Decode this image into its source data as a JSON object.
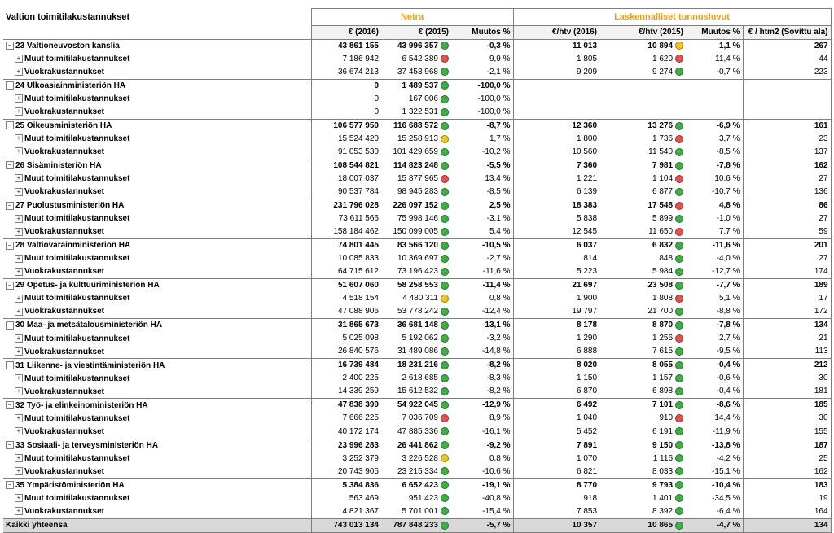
{
  "title": "Valtion toimitilakustannukset",
  "group_headers": {
    "netra": "Netra",
    "lask": "Laskennalliset tunnusluvut"
  },
  "columns": [
    "€ (2016)",
    "€ (2015)",
    "Muutos %",
    "€/htv (2016)",
    "€/htv (2015)",
    "Muutos %",
    "€ / htm2 (Sovittu ala)"
  ],
  "status_colors": {
    "green": "#3cb043",
    "red": "#e8504a",
    "yellow": "#f5c518"
  },
  "toggle_glyphs": {
    "group": "−",
    "sub": "+"
  },
  "rows": [
    {
      "type": "grp",
      "label": "23 Valtioneuvoston kanslia",
      "c2016": "43 861 155",
      "c2015": "43 996 357",
      "s1": "green",
      "p1": "-0,3 %",
      "h2016": "11 013",
      "h2015": "10 894",
      "s2": "yellow",
      "p2": "1,1 %",
      "htm": "267"
    },
    {
      "type": "sub",
      "label": "Muut toimitilakustannukset",
      "c2016": "7 186 942",
      "c2015": "6 542 389",
      "s1": "red",
      "p1": "9,9 %",
      "h2016": "1 805",
      "h2015": "1 620",
      "s2": "red",
      "p2": "11,4 %",
      "htm": "44"
    },
    {
      "type": "sub",
      "label": "Vuokrakustannukset",
      "c2016": "36 674 213",
      "c2015": "37 453 968",
      "s1": "green",
      "p1": "-2,1 %",
      "h2016": "9 209",
      "h2015": "9 274",
      "s2": "green",
      "p2": "-0,7 %",
      "htm": "223"
    },
    {
      "type": "grp",
      "label": "24 Ulkoasiainministeriön HA",
      "c2016": "0",
      "c2015": "1 489 537",
      "s1": "green",
      "p1": "-100,0 %",
      "h2016": "",
      "h2015": "",
      "s2": "",
      "p2": "",
      "htm": ""
    },
    {
      "type": "sub",
      "label": "Muut toimitilakustannukset",
      "c2016": "0",
      "c2015": "167 006",
      "s1": "green",
      "p1": "-100,0 %",
      "h2016": "",
      "h2015": "",
      "s2": "",
      "p2": "",
      "htm": ""
    },
    {
      "type": "sub",
      "label": "Vuokrakustannukset",
      "c2016": "0",
      "c2015": "1 322 531",
      "s1": "green",
      "p1": "-100,0 %",
      "h2016": "",
      "h2015": "",
      "s2": "",
      "p2": "",
      "htm": ""
    },
    {
      "type": "grp",
      "label": "25 Oikeusministeriön HA",
      "c2016": "106 577 950",
      "c2015": "116 688 572",
      "s1": "green",
      "p1": "-8,7 %",
      "h2016": "12 360",
      "h2015": "13 276",
      "s2": "green",
      "p2": "-6,9 %",
      "htm": "161"
    },
    {
      "type": "sub",
      "label": "Muut toimitilakustannukset",
      "c2016": "15 524 420",
      "c2015": "15 258 913",
      "s1": "yellow",
      "p1": "1,7 %",
      "h2016": "1 800",
      "h2015": "1 736",
      "s2": "red",
      "p2": "3,7 %",
      "htm": "23"
    },
    {
      "type": "sub",
      "label": "Vuokrakustannukset",
      "c2016": "91 053 530",
      "c2015": "101 429 659",
      "s1": "green",
      "p1": "-10,2 %",
      "h2016": "10 560",
      "h2015": "11 540",
      "s2": "green",
      "p2": "-8,5 %",
      "htm": "137"
    },
    {
      "type": "grp",
      "label": "26 Sisäministeriön HA",
      "c2016": "108 544 821",
      "c2015": "114 823 248",
      "s1": "green",
      "p1": "-5,5 %",
      "h2016": "7 360",
      "h2015": "7 981",
      "s2": "green",
      "p2": "-7,8 %",
      "htm": "162"
    },
    {
      "type": "sub",
      "label": "Muut toimitilakustannukset",
      "c2016": "18 007 037",
      "c2015": "15 877 965",
      "s1": "red",
      "p1": "13,4 %",
      "h2016": "1 221",
      "h2015": "1 104",
      "s2": "red",
      "p2": "10,6 %",
      "htm": "27"
    },
    {
      "type": "sub",
      "label": "Vuokrakustannukset",
      "c2016": "90 537 784",
      "c2015": "98 945 283",
      "s1": "green",
      "p1": "-8,5 %",
      "h2016": "6 139",
      "h2015": "6 877",
      "s2": "green",
      "p2": "-10,7 %",
      "htm": "136"
    },
    {
      "type": "grp",
      "label": "27 Puolustusministeriön HA",
      "c2016": "231 796 028",
      "c2015": "226 097 152",
      "s1": "green",
      "p1": "2,5 %",
      "h2016": "18 383",
      "h2015": "17 548",
      "s2": "red",
      "p2": "4,8 %",
      "htm": "86"
    },
    {
      "type": "sub",
      "label": "Muut toimitilakustannukset",
      "c2016": "73 611 566",
      "c2015": "75 998 146",
      "s1": "green",
      "p1": "-3,1 %",
      "h2016": "5 838",
      "h2015": "5 899",
      "s2": "green",
      "p2": "-1,0 %",
      "htm": "27"
    },
    {
      "type": "sub",
      "label": "Vuokrakustannukset",
      "c2016": "158 184 462",
      "c2015": "150 099 005",
      "s1": "green",
      "p1": "5,4 %",
      "h2016": "12 545",
      "h2015": "11 650",
      "s2": "red",
      "p2": "7,7 %",
      "htm": "59"
    },
    {
      "type": "grp",
      "label": "28 Valtiovarainministeriön HA",
      "c2016": "74 801 445",
      "c2015": "83 566 120",
      "s1": "green",
      "p1": "-10,5 %",
      "h2016": "6 037",
      "h2015": "6 832",
      "s2": "green",
      "p2": "-11,6 %",
      "htm": "201"
    },
    {
      "type": "sub",
      "label": "Muut toimitilakustannukset",
      "c2016": "10 085 833",
      "c2015": "10 369 697",
      "s1": "green",
      "p1": "-2,7 %",
      "h2016": "814",
      "h2015": "848",
      "s2": "green",
      "p2": "-4,0 %",
      "htm": "27"
    },
    {
      "type": "sub",
      "label": "Vuokrakustannukset",
      "c2016": "64 715 612",
      "c2015": "73 196 423",
      "s1": "green",
      "p1": "-11,6 %",
      "h2016": "5 223",
      "h2015": "5 984",
      "s2": "green",
      "p2": "-12,7 %",
      "htm": "174"
    },
    {
      "type": "grp",
      "label": "29 Opetus- ja kulttuuriministeriön HA",
      "c2016": "51 607 060",
      "c2015": "58 258 553",
      "s1": "green",
      "p1": "-11,4 %",
      "h2016": "21 697",
      "h2015": "23 508",
      "s2": "green",
      "p2": "-7,7 %",
      "htm": "189"
    },
    {
      "type": "sub",
      "label": "Muut toimitilakustannukset",
      "c2016": "4 518 154",
      "c2015": "4 480 311",
      "s1": "yellow",
      "p1": "0,8 %",
      "h2016": "1 900",
      "h2015": "1 808",
      "s2": "red",
      "p2": "5,1 %",
      "htm": "17"
    },
    {
      "type": "sub",
      "label": "Vuokrakustannukset",
      "c2016": "47 088 906",
      "c2015": "53 778 242",
      "s1": "green",
      "p1": "-12,4 %",
      "h2016": "19 797",
      "h2015": "21 700",
      "s2": "green",
      "p2": "-8,8 %",
      "htm": "172"
    },
    {
      "type": "grp",
      "label": "30 Maa- ja metsätalousministeriön HA",
      "c2016": "31 865 673",
      "c2015": "36 681 148",
      "s1": "green",
      "p1": "-13,1 %",
      "h2016": "8 178",
      "h2015": "8 870",
      "s2": "green",
      "p2": "-7,8 %",
      "htm": "134"
    },
    {
      "type": "sub",
      "label": "Muut toimitilakustannukset",
      "c2016": "5 025 098",
      "c2015": "5 192 062",
      "s1": "green",
      "p1": "-3,2 %",
      "h2016": "1 290",
      "h2015": "1 256",
      "s2": "red",
      "p2": "2,7 %",
      "htm": "21"
    },
    {
      "type": "sub",
      "label": "Vuokrakustannukset",
      "c2016": "26 840 576",
      "c2015": "31 489 086",
      "s1": "green",
      "p1": "-14,8 %",
      "h2016": "6 888",
      "h2015": "7 615",
      "s2": "green",
      "p2": "-9,5 %",
      "htm": "113"
    },
    {
      "type": "grp",
      "label": "31 Liikenne- ja viestintäministeriön HA",
      "c2016": "16 739 484",
      "c2015": "18 231 216",
      "s1": "green",
      "p1": "-8,2 %",
      "h2016": "8 020",
      "h2015": "8 055",
      "s2": "green",
      "p2": "-0,4 %",
      "htm": "212"
    },
    {
      "type": "sub",
      "label": "Muut toimitilakustannukset",
      "c2016": "2 400 225",
      "c2015": "2 618 685",
      "s1": "green",
      "p1": "-8,3 %",
      "h2016": "1 150",
      "h2015": "1 157",
      "s2": "green",
      "p2": "-0,6 %",
      "htm": "30"
    },
    {
      "type": "sub",
      "label": "Vuokrakustannukset",
      "c2016": "14 339 259",
      "c2015": "15 612 532",
      "s1": "green",
      "p1": "-8,2 %",
      "h2016": "6 870",
      "h2015": "6 898",
      "s2": "green",
      "p2": "-0,4 %",
      "htm": "181"
    },
    {
      "type": "grp",
      "label": "32 Työ- ja elinkeinoministeriön HA",
      "c2016": "47 838 399",
      "c2015": "54 922 045",
      "s1": "green",
      "p1": "-12,9 %",
      "h2016": "6 492",
      "h2015": "7 101",
      "s2": "green",
      "p2": "-8,6 %",
      "htm": "185"
    },
    {
      "type": "sub",
      "label": "Muut toimitilakustannukset",
      "c2016": "7 666 225",
      "c2015": "7 036 709",
      "s1": "red",
      "p1": "8,9 %",
      "h2016": "1 040",
      "h2015": "910",
      "s2": "red",
      "p2": "14,4 %",
      "htm": "30"
    },
    {
      "type": "sub",
      "label": "Vuokrakustannukset",
      "c2016": "40 172 174",
      "c2015": "47 885 336",
      "s1": "green",
      "p1": "-16,1 %",
      "h2016": "5 452",
      "h2015": "6 191",
      "s2": "green",
      "p2": "-11,9 %",
      "htm": "155"
    },
    {
      "type": "grp",
      "label": "33 Sosiaali- ja terveysministeriön HA",
      "c2016": "23 996 283",
      "c2015": "26 441 862",
      "s1": "green",
      "p1": "-9,2 %",
      "h2016": "7 891",
      "h2015": "9 150",
      "s2": "green",
      "p2": "-13,8 %",
      "htm": "187"
    },
    {
      "type": "sub",
      "label": "Muut toimitilakustannukset",
      "c2016": "3 252 379",
      "c2015": "3 226 528",
      "s1": "yellow",
      "p1": "0,8 %",
      "h2016": "1 070",
      "h2015": "1 116",
      "s2": "green",
      "p2": "-4,2 %",
      "htm": "25"
    },
    {
      "type": "sub",
      "label": "Vuokrakustannukset",
      "c2016": "20 743 905",
      "c2015": "23 215 334",
      "s1": "green",
      "p1": "-10,6 %",
      "h2016": "6 821",
      "h2015": "8 033",
      "s2": "green",
      "p2": "-15,1 %",
      "htm": "162"
    },
    {
      "type": "grp",
      "label": "35 Ympäristöministeriön HA",
      "c2016": "5 384 836",
      "c2015": "6 652 423",
      "s1": "green",
      "p1": "-19,1 %",
      "h2016": "8 770",
      "h2015": "9 793",
      "s2": "green",
      "p2": "-10,4 %",
      "htm": "183"
    },
    {
      "type": "sub",
      "label": "Muut toimitilakustannukset",
      "c2016": "563 469",
      "c2015": "951 423",
      "s1": "green",
      "p1": "-40,8 %",
      "h2016": "918",
      "h2015": "1 401",
      "s2": "green",
      "p2": "-34,5 %",
      "htm": "19"
    },
    {
      "type": "sub",
      "label": "Vuokrakustannukset",
      "c2016": "4 821 367",
      "c2015": "5 701 001",
      "s1": "green",
      "p1": "-15,4 %",
      "h2016": "7 853",
      "h2015": "8 392",
      "s2": "green",
      "p2": "-6,4 %",
      "htm": "164"
    }
  ],
  "total": {
    "label": "Kaikki yhteensä",
    "c2016": "743 013 134",
    "c2015": "787 848 233",
    "s1": "green",
    "p1": "-5,7 %",
    "h2016": "10 357",
    "h2015": "10 865",
    "s2": "green",
    "p2": "-4,7 %",
    "htm": "134"
  }
}
